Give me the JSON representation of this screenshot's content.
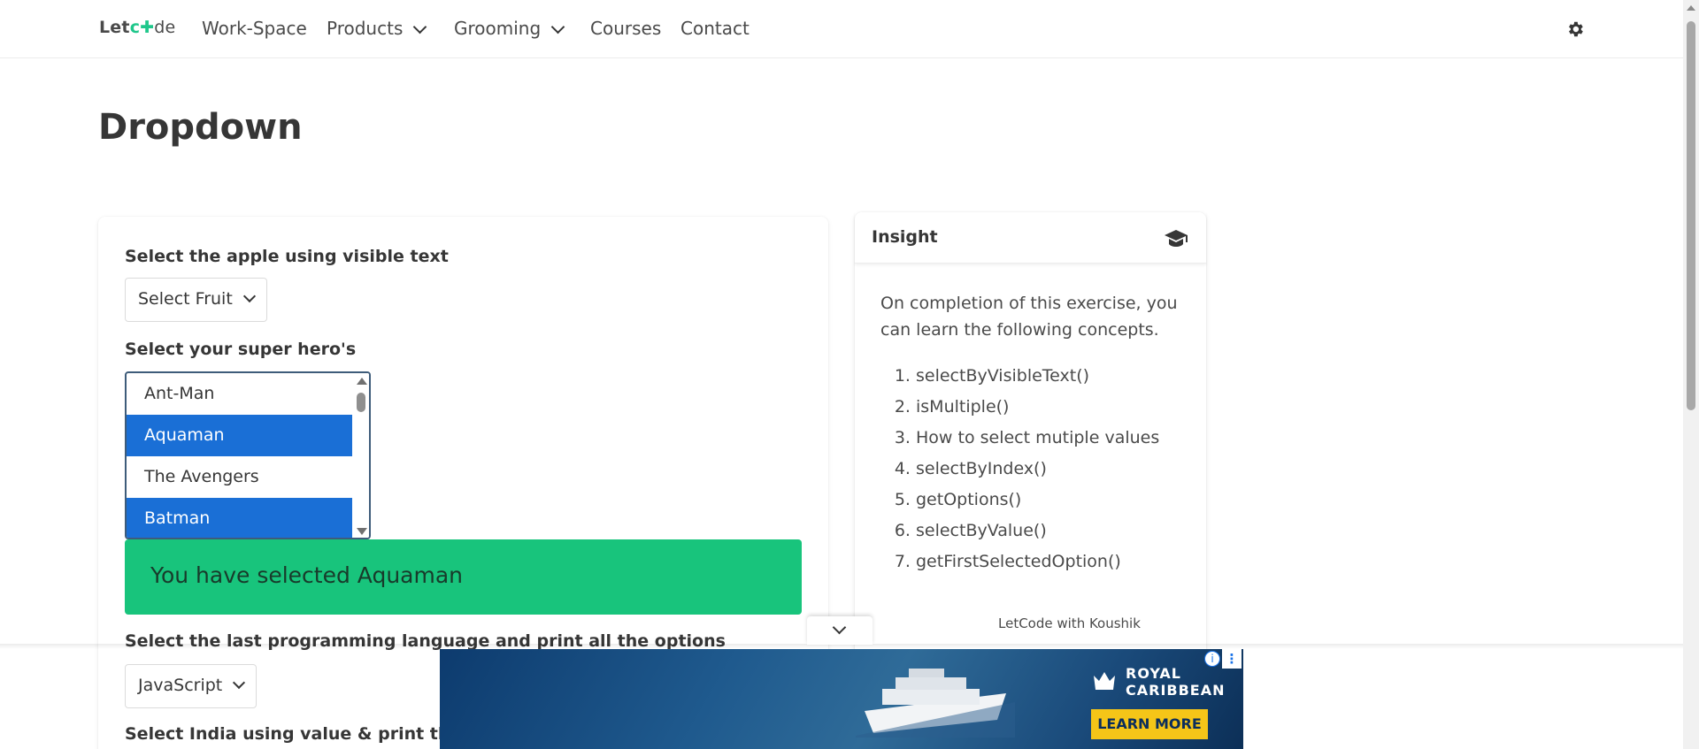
{
  "nav": {
    "logo": {
      "part1": "Let",
      "part2": "c",
      "part3": "de"
    },
    "items": [
      {
        "label": "Work-Space"
      },
      {
        "label": "Products"
      },
      {
        "label": "Grooming"
      },
      {
        "label": "Courses"
      },
      {
        "label": "Contact"
      }
    ],
    "theme_icon": "gear-icon"
  },
  "page": {
    "title": "Dropdown"
  },
  "form": {
    "fruit_label": "Select the apple using visible text",
    "fruit_selected": "Select Fruit",
    "hero_label": "Select your super hero's",
    "hero_options": [
      {
        "text": "Ant-Man",
        "selected": false
      },
      {
        "text": "Aquaman",
        "selected": true
      },
      {
        "text": "The Avengers",
        "selected": false
      },
      {
        "text": "Batman",
        "selected": true
      }
    ],
    "notice": "You have selected Aquaman",
    "lang_label": "Select the last programming language and print all the options",
    "lang_selected": "JavaScript",
    "country_label": "Select India using value & print the selected value"
  },
  "insight": {
    "heading": "Insight",
    "icon": "graduation-cap-icon",
    "intro": "On completion of this exercise, you can learn the following concepts.",
    "items": [
      "selectByVisibleText()",
      "isMultiple()",
      "How to select mutiple values",
      "selectByIndex()",
      "getOptions()",
      "selectByValue()",
      "getFirstSelectedOption()"
    ],
    "credit": "LetCode with Koushik"
  },
  "ad": {
    "brand_line1": "ROYAL",
    "brand_line2": "CARIBBEAN",
    "cta": "LEARN MORE",
    "info": "i",
    "menu": "⋮"
  },
  "colors": {
    "accent_green": "#18c47c",
    "selection_blue": "#1a6fd6",
    "cta_yellow": "#f5c518"
  }
}
